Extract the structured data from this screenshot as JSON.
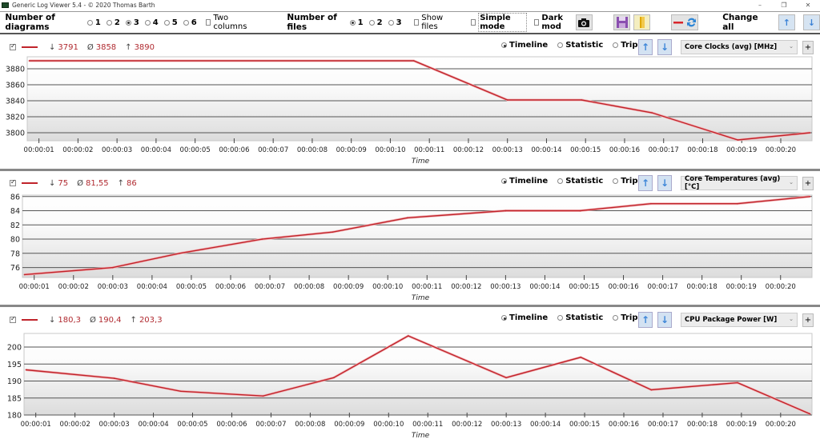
{
  "window": {
    "title": "Generic Log Viewer 5.4 - © 2020 Thomas Barth",
    "controls": [
      "–",
      "❐",
      "✕"
    ]
  },
  "toolbar": {
    "diagrams_label": "Number of diagrams",
    "diagram_options": [
      "1",
      "2",
      "3",
      "4",
      "5",
      "6"
    ],
    "diagram_selected": "3",
    "two_columns_label": "Two columns",
    "two_columns_checked": false,
    "files_label": "Number of files",
    "file_options": [
      "1",
      "2",
      "3"
    ],
    "file_selected": "1",
    "show_files_label": "Show files",
    "show_files_checked": false,
    "simple_mode_label": "Simple mode",
    "simple_mode_checked": false,
    "dark_mode_label": "Dark mod",
    "dark_mode_checked": false,
    "change_all_label": "Change all",
    "icons": {
      "screenshot": "camera-icon",
      "save": "floppy-disk-icon",
      "open": "folder-icon",
      "line_swap": "line-swap-icon",
      "up": "arrow-up-icon",
      "down": "arrow-down-icon"
    }
  },
  "series_color": "#c0242b",
  "panels": [
    {
      "enabled": true,
      "stats": {
        "min_symbol": "↓",
        "min": "3791",
        "avg_symbol": "Ø",
        "avg": "3858",
        "max_symbol": "↑",
        "max": "3890"
      },
      "modes": [
        "Timeline",
        "Statistic",
        "Triple"
      ],
      "mode_selected": "Timeline",
      "sensor": "Core Clocks (avg) [MHz]",
      "plus_label": "+"
    },
    {
      "enabled": true,
      "stats": {
        "min_symbol": "↓",
        "min": "75",
        "avg_symbol": "Ø",
        "avg": "81,55",
        "max_symbol": "↑",
        "max": "86"
      },
      "modes": [
        "Timeline",
        "Statistic",
        "Triple"
      ],
      "mode_selected": "Timeline",
      "sensor": "Core Temperatures (avg) [°C]",
      "plus_label": "+"
    },
    {
      "enabled": true,
      "stats": {
        "min_symbol": "↓",
        "min": "180,3",
        "avg_symbol": "Ø",
        "avg": "190,4",
        "max_symbol": "↑",
        "max": "203,3"
      },
      "modes": [
        "Timeline",
        "Statistic",
        "Triple"
      ],
      "mode_selected": "Timeline",
      "sensor": "CPU Package Power [W]",
      "plus_label": "+"
    }
  ],
  "chart_data": [
    {
      "type": "line",
      "title": "Core Clocks (avg) [MHz]",
      "xlabel": "Time",
      "ylabel": "",
      "xlim": [
        0.7,
        20.8
      ],
      "ylim": [
        3790,
        3895
      ],
      "yticks": [
        3800,
        3820,
        3840,
        3860,
        3880
      ],
      "xticks": [
        "00:00:01",
        "00:00:02",
        "00:00:03",
        "00:00:04",
        "00:00:05",
        "00:00:06",
        "00:00:07",
        "00:00:08",
        "00:00:09",
        "00:00:10",
        "00:00:11",
        "00:00:12",
        "00:00:13",
        "00:00:14",
        "00:00:15",
        "00:00:16",
        "00:00:17",
        "00:00:18",
        "00:00:19",
        "00:00:20"
      ],
      "grid": true,
      "series": [
        {
          "name": "Core Clocks (avg)",
          "x": [
            0.75,
            10.6,
            13.0,
            14.9,
            16.7,
            18.9,
            20.75
          ],
          "y": [
            3890,
            3890,
            3841,
            3841,
            3825,
            3791,
            3800
          ]
        }
      ]
    },
    {
      "type": "line",
      "title": "Core Temperatures (avg) [°C]",
      "xlabel": "Time",
      "ylabel": "",
      "xlim": [
        0.7,
        20.8
      ],
      "ylim": [
        74.6,
        86.2
      ],
      "yticks": [
        76,
        78,
        80,
        82,
        84,
        86
      ],
      "xticks": [
        "00:00:01",
        "00:00:02",
        "00:00:03",
        "00:00:04",
        "00:00:05",
        "00:00:06",
        "00:00:07",
        "00:00:08",
        "00:00:09",
        "00:00:10",
        "00:00:11",
        "00:00:12",
        "00:00:13",
        "00:00:14",
        "00:00:15",
        "00:00:16",
        "00:00:17",
        "00:00:18",
        "00:00:19",
        "00:00:20"
      ],
      "grid": true,
      "series": [
        {
          "name": "Core Temperatures (avg)",
          "x": [
            0.75,
            3.0,
            4.7,
            6.8,
            8.6,
            10.5,
            13.0,
            14.9,
            16.7,
            18.9,
            20.75
          ],
          "y": [
            75,
            76,
            78,
            80,
            81,
            83,
            84,
            84,
            85,
            85,
            86
          ]
        }
      ]
    },
    {
      "type": "line",
      "title": "CPU Package Power [W]",
      "xlabel": "Time",
      "ylabel": "",
      "xlim": [
        0.7,
        20.8
      ],
      "ylim": [
        180,
        204
      ],
      "yticks": [
        180,
        185,
        190,
        195,
        200
      ],
      "xticks": [
        "00:00:01",
        "00:00:02",
        "00:00:03",
        "00:00:04",
        "00:00:05",
        "00:00:06",
        "00:00:07",
        "00:00:08",
        "00:00:09",
        "00:00:10",
        "00:00:11",
        "00:00:12",
        "00:00:13",
        "00:00:14",
        "00:00:15",
        "00:00:16",
        "00:00:17",
        "00:00:18",
        "00:00:19",
        "00:00:20"
      ],
      "grid": true,
      "series": [
        {
          "name": "CPU Package Power",
          "x": [
            0.75,
            3.0,
            4.7,
            6.8,
            8.6,
            10.5,
            13.0,
            14.9,
            16.7,
            18.9,
            20.75
          ],
          "y": [
            193.3,
            190.8,
            187.0,
            185.6,
            191.0,
            203.3,
            191.0,
            197.0,
            187.4,
            189.5,
            180.3
          ]
        }
      ]
    }
  ]
}
